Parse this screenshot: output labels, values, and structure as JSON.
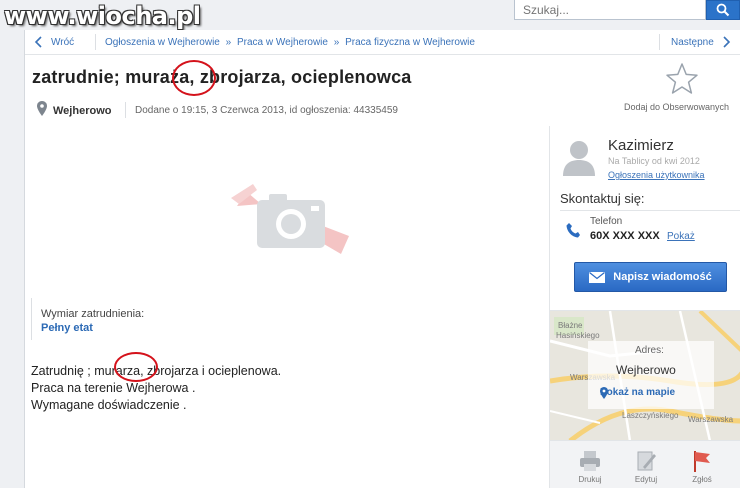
{
  "watermark": "www.wiocha.pl",
  "search": {
    "placeholder": "Szukaj..."
  },
  "nav": {
    "back_label": "Wróć",
    "breadcrumbs": [
      "Ogłoszenia w Wejherowie",
      "Praca w Wejherowie",
      "Praca fizyczna w Wejherowie"
    ],
    "breadcrumb_separator": "»",
    "next_label": "Następne"
  },
  "listing": {
    "title": "zatrudnie; muraża, zbrojarza, ocieplenowca",
    "observe_label": "Dodaj do Obserwowanych",
    "city": "Wejherowo",
    "added": "Dodane o 19:15, 3 Czerwca 2013, id ogłoszenia: 44335459",
    "employment_label": "Wymiar zatrudnienia:",
    "employment_value": "Pełny etat",
    "description": [
      "Zatrudnię ; murarza, zbrojarza i ocieplenowa.",
      "Praca na terenie Wejherowa .",
      "Wymagane doświadczenie ."
    ]
  },
  "seller": {
    "name": "Kazimierz",
    "since": "Na Tablicy od kwi 2012",
    "ads_link": "Ogłoszenia użytkownika",
    "contact_heading": "Skontaktuj się:",
    "phone_label": "Telefon",
    "phone_number": "60X XXX XXX",
    "phone_show": "Pokaż",
    "message_button": "Napisz wiadomość"
  },
  "map": {
    "labels": [
      "Błażne",
      "Hasińskiego",
      "Warszawska",
      "Warszawska",
      "Laszczyńskiego"
    ],
    "address_label": "Adres:",
    "address_city": "Wejherowo",
    "show_on_map": "Pokaż na mapie"
  },
  "actions": [
    {
      "label": "Drukuj",
      "icon": "printer-icon"
    },
    {
      "label": "Edytuj",
      "icon": "edit-icon"
    },
    {
      "label": "Zgłoś",
      "icon": "report-flag-icon"
    }
  ],
  "colors": {
    "accent": "#2b73c9",
    "link": "#3b73b9",
    "annotation_circle": "#d4121b",
    "button": "#3a7bd5"
  }
}
